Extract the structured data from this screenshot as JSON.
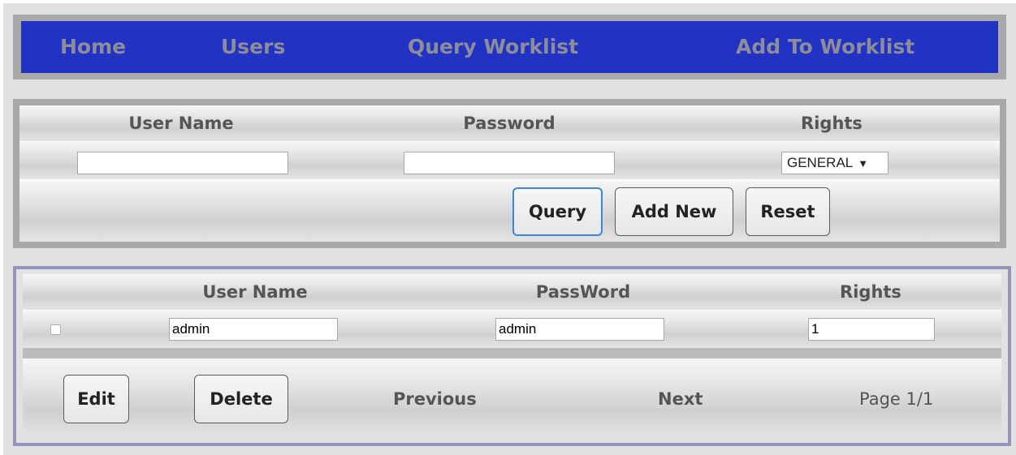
{
  "nav": {
    "items": [
      {
        "label": "Home"
      },
      {
        "label": "Users"
      },
      {
        "label": "Query Worklist"
      },
      {
        "label": "Add To Worklist"
      }
    ]
  },
  "query_form": {
    "headers": {
      "username": "User Name",
      "password": "Password",
      "rights": "Rights"
    },
    "username_value": "",
    "password_value": "",
    "rights_selected": "GENERAL",
    "buttons": {
      "query": "Query",
      "add_new": "Add New",
      "reset": "Reset"
    }
  },
  "results": {
    "headers": {
      "username": "User Name",
      "password": "PassWord",
      "rights": "Rights"
    },
    "rows": [
      {
        "checked": false,
        "username": "admin",
        "password": "admin",
        "rights": "1"
      }
    ],
    "footer": {
      "edit": "Edit",
      "delete": "Delete",
      "previous": "Previous",
      "next": "Next",
      "page_info": "Page 1/1"
    }
  }
}
